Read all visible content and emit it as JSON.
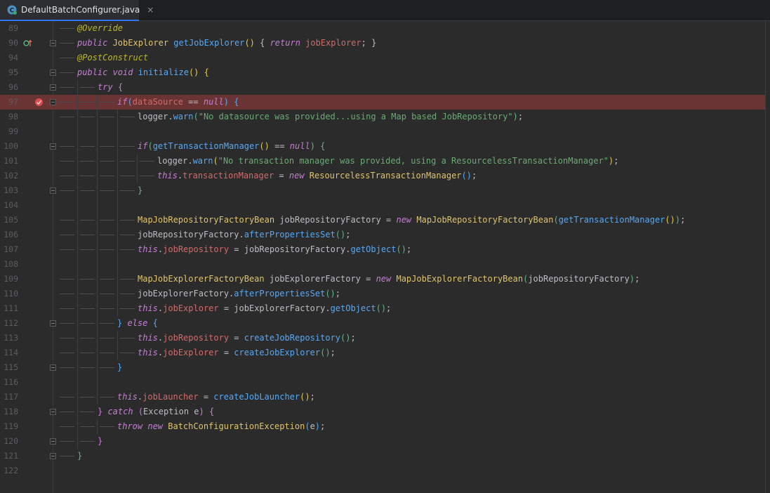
{
  "tab": {
    "filename": "DefaultBatchConfigurer.java",
    "close": "×",
    "icon": "java-class-icon"
  },
  "colors": {
    "breakpoint_line": "#6b3434",
    "keyword": "#c57fd4",
    "method": "#56a8f5",
    "field": "#d16a6a",
    "string": "#6aab73",
    "class": "#e0c46c",
    "annotation": "#bbb529"
  },
  "lines": [
    {
      "n": "89",
      "indent": 0,
      "segs": [
        [
          "ann",
          "@Override"
        ]
      ]
    },
    {
      "n": "90",
      "indent": 0,
      "icon": "override-icon",
      "fold": true,
      "segs": [
        [
          "kwp",
          "public "
        ],
        [
          "cls",
          "JobExplorer "
        ],
        [
          "mth",
          "getJobExplorer"
        ],
        [
          "br1",
          "() "
        ],
        [
          "txt",
          "{ "
        ],
        [
          "kwp",
          "return "
        ],
        [
          "fld",
          "jobExplorer"
        ],
        [
          "txt",
          "; }"
        ]
      ]
    },
    {
      "n": "94",
      "indent": 0,
      "segs": [
        [
          "ann",
          "@PostConstruct"
        ]
      ]
    },
    {
      "n": "95",
      "indent": 0,
      "fold": true,
      "segs": [
        [
          "kwp",
          "public void "
        ],
        [
          "mth",
          "initialize"
        ],
        [
          "br1",
          "() {"
        ]
      ]
    },
    {
      "n": "96",
      "indent": 1,
      "fold": true,
      "segs": [
        [
          "kwp",
          "try "
        ],
        [
          "br2",
          "{"
        ]
      ]
    },
    {
      "n": "97",
      "indent": 2,
      "icon": "breakpoint-icon",
      "fold": true,
      "highlight": true,
      "segs": [
        [
          "kwp",
          "if"
        ],
        [
          "br3",
          "("
        ],
        [
          "fld",
          "dataSource "
        ],
        [
          "txt",
          "== "
        ],
        [
          "kwp",
          "null"
        ],
        [
          "br3",
          ") "
        ],
        [
          "br3",
          "{"
        ]
      ]
    },
    {
      "n": "98",
      "indent": 3,
      "segs": [
        [
          "txt",
          "logger."
        ],
        [
          "mth",
          "warn"
        ],
        [
          "br4",
          "("
        ],
        [
          "str",
          "\"No datasource was provided...using a Map based JobRepository\""
        ],
        [
          "br4",
          ")"
        ],
        [
          "txt",
          ";"
        ]
      ]
    },
    {
      "n": "99",
      "indent": 3,
      "segs": []
    },
    {
      "n": "100",
      "indent": 3,
      "fold": true,
      "segs": [
        [
          "kwp",
          "if"
        ],
        [
          "br4",
          "("
        ],
        [
          "mth",
          "getTransactionManager"
        ],
        [
          "br1",
          "() "
        ],
        [
          "txt",
          "== "
        ],
        [
          "kwp",
          "null"
        ],
        [
          "br4",
          ") "
        ],
        [
          "br4",
          "{"
        ]
      ]
    },
    {
      "n": "101",
      "indent": 4,
      "segs": [
        [
          "txt",
          "logger."
        ],
        [
          "mth",
          "warn"
        ],
        [
          "br1",
          "("
        ],
        [
          "str",
          "\"No transaction manager was provided, using a ResourcelessTransactionManager\""
        ],
        [
          "br1",
          ")"
        ],
        [
          "txt",
          ";"
        ]
      ]
    },
    {
      "n": "102",
      "indent": 4,
      "segs": [
        [
          "kwp",
          "this"
        ],
        [
          "txt",
          "."
        ],
        [
          "fld",
          "transactionManager "
        ],
        [
          "txt",
          "= "
        ],
        [
          "kwp",
          "new "
        ],
        [
          "cls",
          "ResourcelessTransactionManager"
        ],
        [
          "br3",
          "()"
        ],
        [
          "txt",
          ";"
        ]
      ]
    },
    {
      "n": "103",
      "indent": 3,
      "fold": true,
      "segs": [
        [
          "br4",
          "}"
        ]
      ]
    },
    {
      "n": "104",
      "indent": 3,
      "segs": []
    },
    {
      "n": "105",
      "indent": 3,
      "segs": [
        [
          "cls",
          "MapJobRepositoryFactoryBean "
        ],
        [
          "txt",
          "jobRepositoryFactory = "
        ],
        [
          "kwp",
          "new "
        ],
        [
          "cls",
          "MapJobRepositoryFactoryBean"
        ],
        [
          "br4",
          "("
        ],
        [
          "mth",
          "getTransactionManager"
        ],
        [
          "br1",
          "()"
        ],
        [
          "br4",
          ")"
        ],
        [
          "txt",
          ";"
        ]
      ]
    },
    {
      "n": "106",
      "indent": 3,
      "segs": [
        [
          "txt",
          "jobRepositoryFactory."
        ],
        [
          "mth",
          "afterPropertiesSet"
        ],
        [
          "br4",
          "()"
        ],
        [
          "txt",
          ";"
        ]
      ]
    },
    {
      "n": "107",
      "indent": 3,
      "segs": [
        [
          "kwp",
          "this"
        ],
        [
          "txt",
          "."
        ],
        [
          "fld",
          "jobRepository "
        ],
        [
          "txt",
          "= jobRepositoryFactory."
        ],
        [
          "mth",
          "getObject"
        ],
        [
          "br4",
          "()"
        ],
        [
          "txt",
          ";"
        ]
      ]
    },
    {
      "n": "108",
      "indent": 3,
      "segs": []
    },
    {
      "n": "109",
      "indent": 3,
      "segs": [
        [
          "cls",
          "MapJobExplorerFactoryBean "
        ],
        [
          "txt",
          "jobExplorerFactory = "
        ],
        [
          "kwp",
          "new "
        ],
        [
          "cls",
          "MapJobExplorerFactoryBean"
        ],
        [
          "br4",
          "("
        ],
        [
          "txt",
          "jobRepositoryFactory"
        ],
        [
          "br4",
          ")"
        ],
        [
          "txt",
          ";"
        ]
      ]
    },
    {
      "n": "110",
      "indent": 3,
      "segs": [
        [
          "txt",
          "jobExplorerFactory."
        ],
        [
          "mth",
          "afterPropertiesSet"
        ],
        [
          "br4",
          "()"
        ],
        [
          "txt",
          ";"
        ]
      ]
    },
    {
      "n": "111",
      "indent": 3,
      "segs": [
        [
          "kwp",
          "this"
        ],
        [
          "txt",
          "."
        ],
        [
          "fld",
          "jobExplorer "
        ],
        [
          "txt",
          "= jobExplorerFactory."
        ],
        [
          "mth",
          "getObject"
        ],
        [
          "br4",
          "()"
        ],
        [
          "txt",
          ";"
        ]
      ]
    },
    {
      "n": "112",
      "indent": 2,
      "fold": true,
      "segs": [
        [
          "br3",
          "} "
        ],
        [
          "kwp",
          "else "
        ],
        [
          "br3",
          "{"
        ]
      ]
    },
    {
      "n": "113",
      "indent": 3,
      "segs": [
        [
          "kwp",
          "this"
        ],
        [
          "txt",
          "."
        ],
        [
          "fld",
          "jobRepository "
        ],
        [
          "txt",
          "= "
        ],
        [
          "mth",
          "createJobRepository"
        ],
        [
          "br4",
          "()"
        ],
        [
          "txt",
          ";"
        ]
      ]
    },
    {
      "n": "114",
      "indent": 3,
      "segs": [
        [
          "kwp",
          "this"
        ],
        [
          "txt",
          "."
        ],
        [
          "fld",
          "jobExplorer "
        ],
        [
          "txt",
          "= "
        ],
        [
          "mth",
          "createJobExplorer"
        ],
        [
          "br4",
          "()"
        ],
        [
          "txt",
          ";"
        ]
      ]
    },
    {
      "n": "115",
      "indent": 2,
      "fold": true,
      "segs": [
        [
          "br3",
          "}"
        ]
      ]
    },
    {
      "n": "116",
      "indent": 2,
      "segs": []
    },
    {
      "n": "117",
      "indent": 2,
      "segs": [
        [
          "kwp",
          "this"
        ],
        [
          "txt",
          "."
        ],
        [
          "fld",
          "jobLauncher "
        ],
        [
          "txt",
          "= "
        ],
        [
          "mth",
          "createJobLauncher"
        ],
        [
          "br1",
          "()"
        ],
        [
          "txt",
          ";"
        ]
      ]
    },
    {
      "n": "118",
      "indent": 1,
      "fold": true,
      "segs": [
        [
          "br2",
          "} "
        ],
        [
          "kwp",
          "catch "
        ],
        [
          "br2",
          "("
        ],
        [
          "txt",
          "Exception e"
        ],
        [
          "br2",
          ") "
        ],
        [
          "br2",
          "{"
        ]
      ]
    },
    {
      "n": "119",
      "indent": 2,
      "segs": [
        [
          "kwp",
          "throw new "
        ],
        [
          "cls",
          "BatchConfigurationException"
        ],
        [
          "br3",
          "("
        ],
        [
          "txt",
          "e"
        ],
        [
          "br3",
          ")"
        ],
        [
          "txt",
          ";"
        ]
      ]
    },
    {
      "n": "120",
      "indent": 1,
      "fold": true,
      "segs": [
        [
          "br2",
          "}"
        ]
      ]
    },
    {
      "n": "121",
      "indent": 0,
      "fold": true,
      "segs": [
        [
          "br4",
          "}"
        ]
      ]
    },
    {
      "n": "122",
      "indent": 0,
      "segs": []
    }
  ]
}
